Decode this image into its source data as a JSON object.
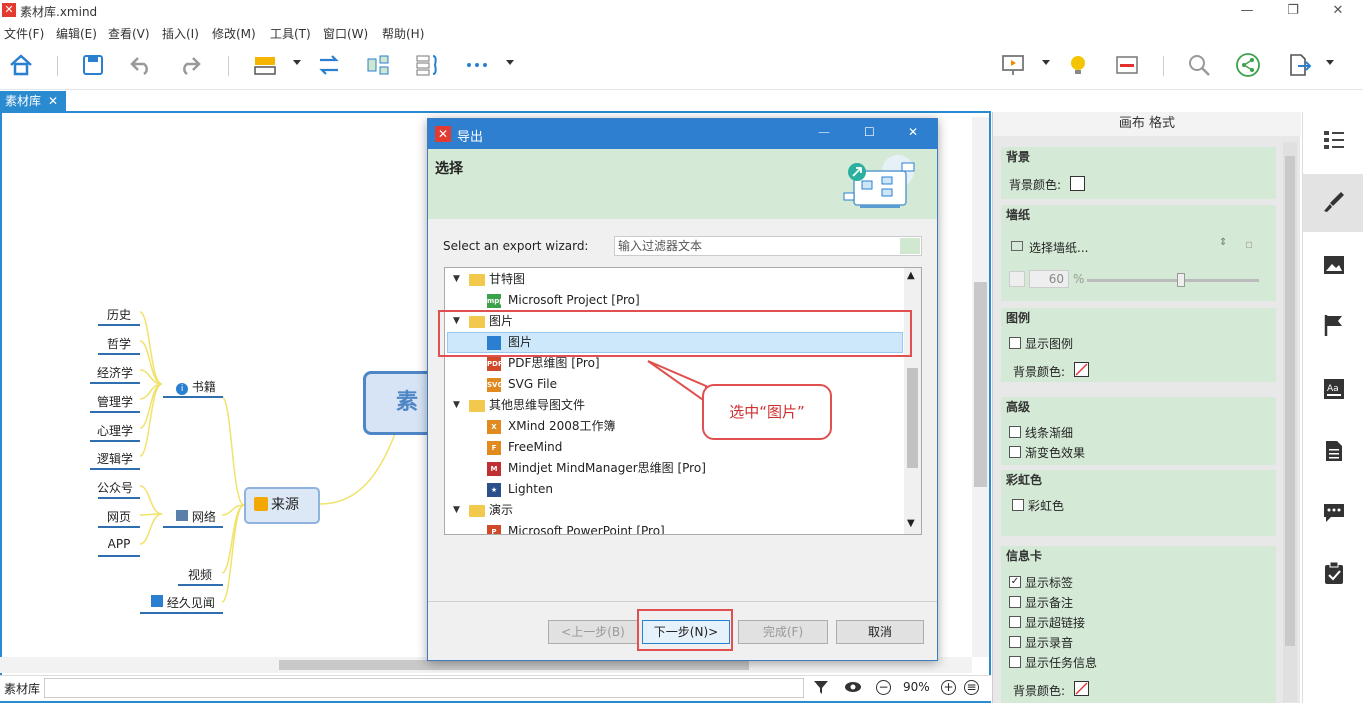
{
  "window": {
    "title": "素材库.xmind"
  },
  "menu": [
    "文件(F)",
    "编辑(E)",
    "查看(V)",
    "插入(I)",
    "修改(M)",
    "工具(T)",
    "窗口(W)",
    "帮助(H)"
  ],
  "tab": {
    "label": "素材库",
    "close": "✕"
  },
  "mindmap": {
    "central": "素材",
    "source": "来源",
    "books": "书籍",
    "network": "网络",
    "video": "视频",
    "news": "经久见闻",
    "book_items": [
      "历史",
      "哲学",
      "经济学",
      "管理学",
      "心理学",
      "逻辑学"
    ],
    "net_items": [
      "公众号",
      "网页",
      "APP"
    ]
  },
  "status": {
    "sheet": "素材库",
    "zoom": "90%"
  },
  "panel": {
    "title": "画布 格式",
    "background": {
      "head": "背景",
      "color_label": "背景颜色:"
    },
    "wallpaper": {
      "head": "墙纸",
      "select": "选择墙纸...",
      "opacity": "60",
      "unit": "%"
    },
    "legend": {
      "head": "图例",
      "show": "显示图例",
      "color_label": "背景颜色:"
    },
    "advanced": {
      "head": "高级",
      "line_taper": "线条渐细",
      "gradient": "渐变色效果"
    },
    "rainbow": {
      "head": "彩虹色",
      "rainbow": "彩虹色"
    },
    "info_card": {
      "head": "信息卡",
      "items": [
        "显示标签",
        "显示备注",
        "显示超链接",
        "显示录音",
        "显示任务信息"
      ],
      "checked": [
        true,
        false,
        false,
        false,
        false
      ],
      "color_label": "背景颜色:"
    }
  },
  "dialog": {
    "title": "导出",
    "heading": "选择",
    "wizard_label": "Select an export wizard:",
    "filter_placeholder": "输入过滤器文本",
    "tree": [
      {
        "type": "folder",
        "label": "甘特图"
      },
      {
        "type": "file",
        "label": "Microsoft Project [Pro]",
        "icon": "mpp"
      },
      {
        "type": "folder",
        "label": "图片"
      },
      {
        "type": "file",
        "label": "图片",
        "icon": "image",
        "selected": true
      },
      {
        "type": "file",
        "label": "PDF思维图 [Pro]",
        "icon": "pdf"
      },
      {
        "type": "file",
        "label": "SVG File",
        "icon": "svg"
      },
      {
        "type": "folder",
        "label": "其他思维导图文件"
      },
      {
        "type": "file",
        "label": "XMind 2008工作簿",
        "icon": "xmind"
      },
      {
        "type": "file",
        "label": "FreeMind",
        "icon": "freemind"
      },
      {
        "type": "file",
        "label": "Mindjet MindManager思维图 [Pro]",
        "icon": "mindjet"
      },
      {
        "type": "file",
        "label": "Lighten",
        "icon": "lighten"
      },
      {
        "type": "folder",
        "label": "演示"
      },
      {
        "type": "file",
        "label": "Microsoft PowerPoint [Pro]",
        "icon": "ppt"
      }
    ],
    "buttons": {
      "back": "<上一步(B)",
      "next": "下一步(N)>",
      "finish": "完成(F)",
      "cancel": "取消"
    }
  },
  "callout": "选中“图片”"
}
